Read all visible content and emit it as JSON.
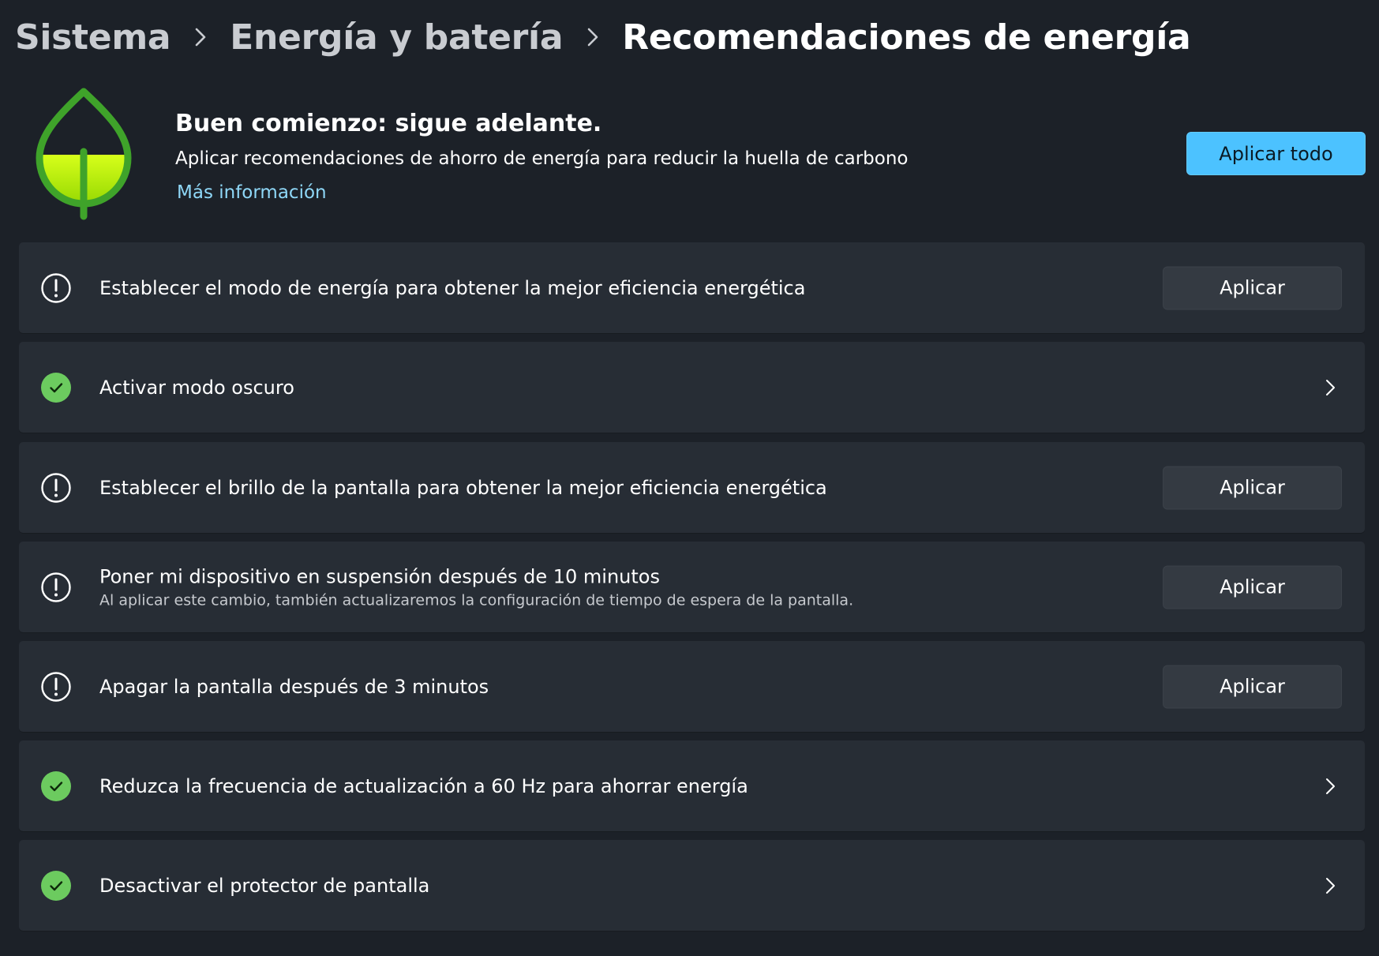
{
  "breadcrumb": {
    "items": [
      "Sistema",
      "Energía y batería",
      "Recomendaciones de energía"
    ]
  },
  "hero": {
    "icon": "leaf-icon",
    "title": "Buen comienzo: sigue adelante.",
    "subtitle": "Aplicar recomendaciones de ahorro de energía para reducir la huella de carbono",
    "link": "Más información",
    "apply_all_label": "Aplicar todo"
  },
  "recommendations": [
    {
      "status": "pending",
      "icon": "warning-icon",
      "title": "Establecer el modo de energía para obtener la mejor eficiencia energética",
      "description": "",
      "action": "Aplicar"
    },
    {
      "status": "done",
      "icon": "checkmark-icon",
      "title": "Activar modo oscuro",
      "description": "",
      "action": ""
    },
    {
      "status": "pending",
      "icon": "warning-icon",
      "title": "Establecer el brillo de la pantalla para obtener la mejor eficiencia energética",
      "description": "",
      "action": "Aplicar"
    },
    {
      "status": "pending",
      "icon": "warning-icon",
      "title": "Poner mi dispositivo en suspensión después de 10 minutos",
      "description": "Al aplicar este cambio, también actualizaremos la configuración de tiempo de espera de la pantalla.",
      "action": "Aplicar"
    },
    {
      "status": "pending",
      "icon": "warning-icon",
      "title": "Apagar la pantalla después de 3 minutos",
      "description": "",
      "action": "Aplicar"
    },
    {
      "status": "done",
      "icon": "checkmark-icon",
      "title": "Reduzca la frecuencia de actualización a 60 Hz para ahorrar energía",
      "description": "",
      "action": ""
    },
    {
      "status": "done",
      "icon": "checkmark-icon",
      "title": "Desactivar el protector de pantalla",
      "description": "",
      "action": ""
    }
  ],
  "colors": {
    "background": "#1c2128",
    "card": "#272d35",
    "accent": "#4cc2ff",
    "link": "#8fd8f8",
    "success": "#6ccb5f",
    "leaf": "#3fa32a",
    "leaf_fill": "#b4f000"
  }
}
